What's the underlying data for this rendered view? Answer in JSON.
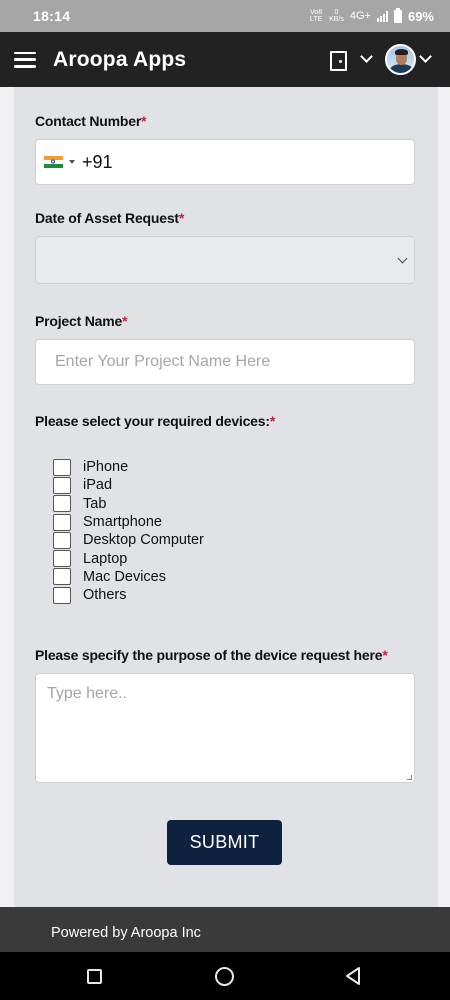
{
  "status_bar": {
    "time": "18:14",
    "volte": "Vo8 LTE",
    "speed_value": "0",
    "speed_unit": "KB/s",
    "network": "4G+",
    "battery": "69%"
  },
  "app_bar": {
    "title": "Aroopa Apps",
    "icons": [
      "menu-icon",
      "door-icon",
      "chevron-down-icon",
      "avatar",
      "chevron-down-icon"
    ]
  },
  "form": {
    "contact": {
      "label": "Contact Number",
      "required_mark": "*",
      "country": "India",
      "dial_code": "+91"
    },
    "date": {
      "label": "Date of Asset Request",
      "required_mark": "*",
      "value": ""
    },
    "project": {
      "label": "Project Name",
      "required_mark": "*",
      "placeholder": "Enter Your Project Name Here"
    },
    "devices": {
      "label": "Please select your required devices:",
      "required_mark": "*",
      "options": [
        {
          "label": "iPhone",
          "checked": false
        },
        {
          "label": "iPad",
          "checked": false
        },
        {
          "label": "Tab",
          "checked": false
        },
        {
          "label": "Smartphone",
          "checked": false
        },
        {
          "label": "Desktop Computer",
          "checked": false
        },
        {
          "label": "Laptop",
          "checked": false
        },
        {
          "label": "Mac Devices",
          "checked": false
        },
        {
          "label": "Others",
          "checked": false
        }
      ]
    },
    "purpose": {
      "label": "Please specify the purpose of the device request here",
      "required_mark": "*",
      "placeholder": "Type here.."
    },
    "submit_label": "SUBMIT"
  },
  "footer": {
    "text": "Powered by Aroopa Inc"
  },
  "colors": {
    "app_bar": "#222222",
    "card": "#e1e2e5",
    "required": "#c2213c",
    "submit": "#0e2240",
    "footer": "#3a3a3a"
  }
}
